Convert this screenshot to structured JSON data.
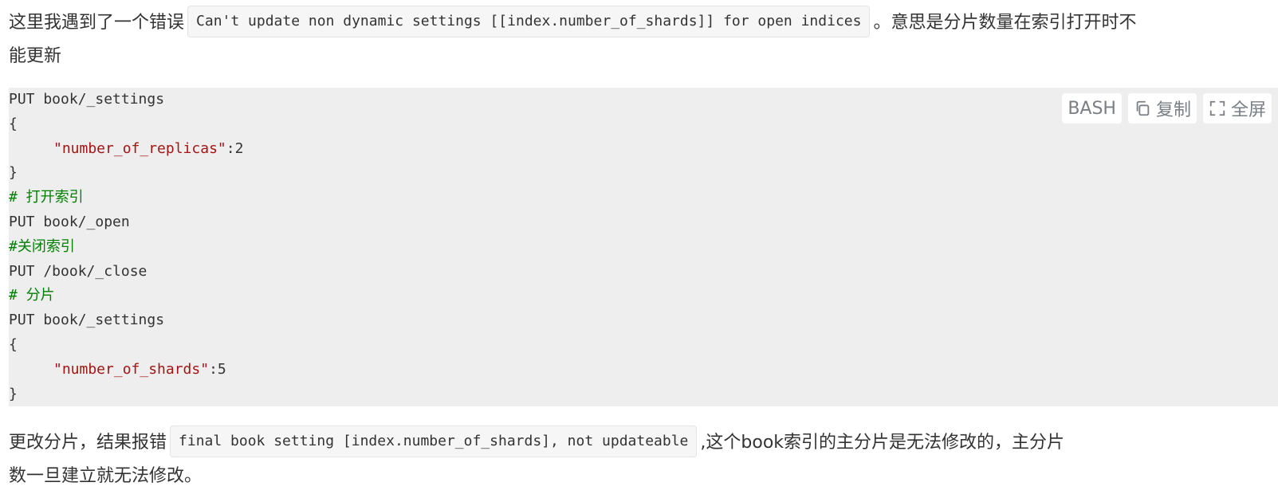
{
  "intro": {
    "before_code": "这里我遇到了一个错误",
    "code": "Can't update non dynamic settings [[index.number_of_shards]] for open indices",
    "after_code": "。意思是分片数量在索引打开时不",
    "line2": "能更新"
  },
  "code_block": {
    "language_label": "BASH",
    "copy_label": "复制",
    "fullscreen_label": "全屏",
    "lines": [
      {
        "type": "plain",
        "text": "PUT book/_settings"
      },
      {
        "type": "plain",
        "text": "{"
      },
      {
        "type": "kv",
        "key": "\"number_of_replicas\"",
        "rest": ":2"
      },
      {
        "type": "plain",
        "text": "}"
      },
      {
        "type": "comment",
        "text": "# 打开索引"
      },
      {
        "type": "plain",
        "text": "PUT book/_open"
      },
      {
        "type": "comment",
        "text": "#关闭索引"
      },
      {
        "type": "plain",
        "text": "PUT /book/_close"
      },
      {
        "type": "comment",
        "text": "# 分片"
      },
      {
        "type": "plain",
        "text": "PUT book/_settings"
      },
      {
        "type": "plain",
        "text": "{"
      },
      {
        "type": "kv",
        "key": "\"number_of_shards\"",
        "rest": ":5"
      },
      {
        "type": "plain",
        "text": "}"
      }
    ]
  },
  "outro": {
    "before_code": "更改分片，结果报错",
    "code": "final book setting [index.number_of_shards], not updateable",
    "after_code": ",这个book索引的主分片是无法修改的，主分片",
    "line2": "数一旦建立就无法修改。"
  },
  "colors": {
    "code_bg": "#eeeeee",
    "string": "#a31515",
    "comment": "#008000",
    "toolbar_text": "#7a7f85"
  },
  "icons": {
    "copy": "copy-icon",
    "fullscreen": "fullscreen-icon"
  }
}
